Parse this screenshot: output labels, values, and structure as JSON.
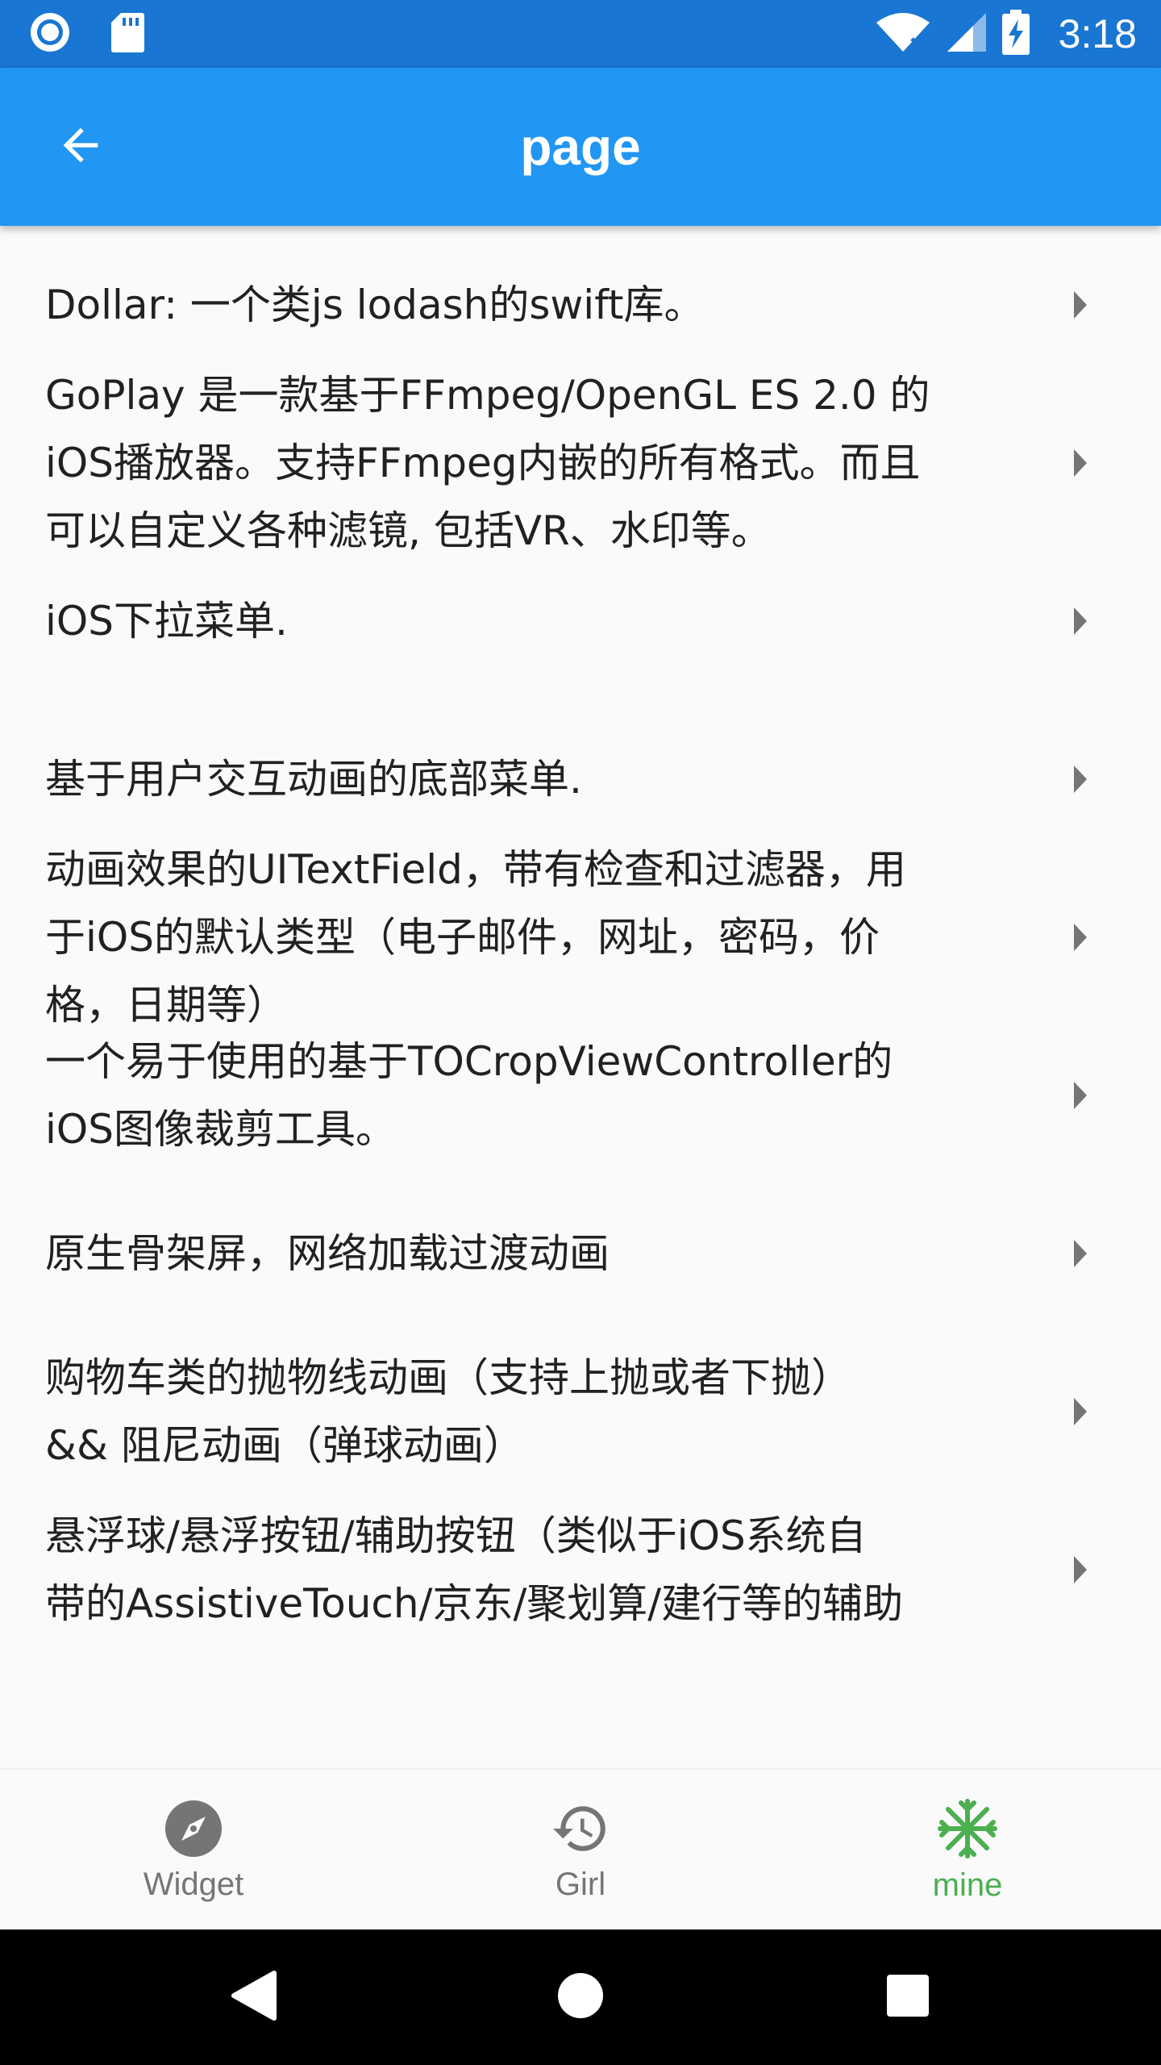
{
  "status_bar": {
    "time": "3:18",
    "icons": [
      "circle-notification-icon",
      "sd-card-icon",
      "wifi-icon",
      "signal-icon",
      "battery-charging-icon"
    ]
  },
  "app_bar": {
    "title": "page",
    "back_icon": "arrow-back-icon"
  },
  "list": {
    "items": [
      {
        "lines": [
          "Dollar: 一个类js lodash的swift库。"
        ]
      },
      {
        "lines": [
          "GoPlay 是一款基于FFmpeg/OpenGL ES 2.0 的",
          "iOS播放器。支持FFmpeg内嵌的所有格式。而且",
          "可以自定义各种滤镜, 包括VR、水印等。"
        ]
      },
      {
        "lines": [
          "iOS下拉菜单."
        ]
      },
      {
        "lines": [
          "基于用户交互动画的底部菜单."
        ]
      },
      {
        "lines": [
          "动画效果的UITextField，带有检查和过滤器，用",
          "于iOS的默认类型（电子邮件，网址，密码，价",
          "格，日期等）"
        ]
      },
      {
        "lines": [
          "一个易于使用的基于TOCropViewController的",
          "iOS图像裁剪工具。"
        ]
      },
      {
        "lines": [
          "原生骨架屏，网络加载过渡动画"
        ]
      },
      {
        "lines": [
          "购物车类的抛物线动画（支持上抛或者下抛）",
          "&& 阻尼动画（弹球动画）"
        ]
      },
      {
        "lines": [
          "悬浮球/悬浮按钮/辅助按钮（类似于iOS系统自",
          "带的AssistiveTouch/京东/聚划算/建行等的辅助"
        ]
      }
    ],
    "trailing_icon": "arrow-right-icon"
  },
  "bottom_nav": {
    "items": [
      {
        "label": "Widget",
        "icon": "compass-icon",
        "active": false
      },
      {
        "label": "Girl",
        "icon": "history-icon",
        "active": false
      },
      {
        "label": "mine",
        "icon": "snowflake-icon",
        "active": true
      }
    ],
    "active_color": "#4CAF50",
    "inactive_color": "#757575"
  },
  "colors": {
    "status_bar": "#1976D2",
    "app_bar": "#2196F3",
    "background": "#FAFAFA",
    "text": "#212121"
  }
}
